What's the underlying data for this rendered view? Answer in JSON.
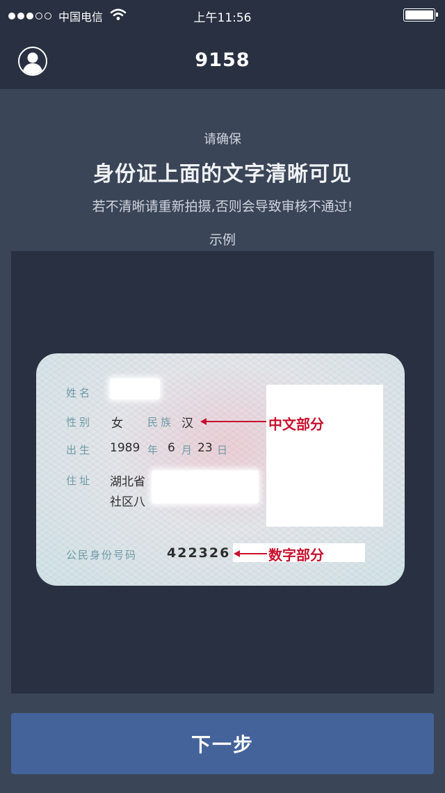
{
  "status_bar": {
    "carrier": "中国电信",
    "time": "上午11:56",
    "signal_icon": "signal-dots-icon",
    "wifi_icon": "wifi-icon",
    "battery_icon": "battery-icon",
    "battery_level": 1.0
  },
  "nav": {
    "title": "9158",
    "avatar_icon": "user-avatar-icon"
  },
  "instructions": {
    "prompt": "请确保",
    "headline": "身份证上面的文字清晰可见",
    "subtitle": "若不清晰请重新拍摄,否则会导致审核不通过!",
    "example_label": "示例"
  },
  "id_card": {
    "name_label": "姓名",
    "gender_label": "性别",
    "gender_value": "女",
    "ethnicity_label": "民族",
    "ethnicity_value": "汉",
    "birth_label": "出生",
    "birth_year": "1989",
    "year_char": "年",
    "birth_month": "6",
    "month_char": "月",
    "birth_day": "23",
    "day_char": "日",
    "address_label": "住址",
    "address_line1": "湖北省",
    "address_line2": "社区八",
    "id_number_label": "公民身份号码",
    "id_number_value": "422326",
    "chinese_annotation": "中文部分",
    "number_annotation": "数字部分"
  },
  "actions": {
    "next_label": "下一步"
  },
  "colors": {
    "background": "#3a4557",
    "header": "#283041",
    "panel": "#283041",
    "button": "#44639a",
    "annotation": "#c8102e"
  }
}
